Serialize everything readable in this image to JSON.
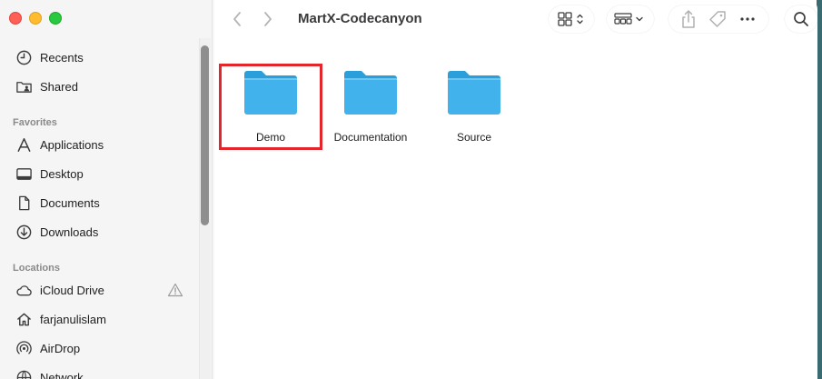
{
  "window": {
    "title": "MartX-Codecanyon"
  },
  "sidebar": {
    "items_top": [
      {
        "label": "Recents",
        "icon": "clock-icon"
      },
      {
        "label": "Shared",
        "icon": "shared-folder-icon"
      }
    ],
    "favorites_title": "Favorites",
    "favorites": [
      {
        "label": "Applications",
        "icon": "applications-icon"
      },
      {
        "label": "Desktop",
        "icon": "desktop-icon"
      },
      {
        "label": "Documents",
        "icon": "document-icon"
      },
      {
        "label": "Downloads",
        "icon": "download-icon"
      }
    ],
    "locations_title": "Locations",
    "locations": [
      {
        "label": "iCloud Drive",
        "icon": "cloud-icon"
      },
      {
        "label": "farjanulislam",
        "icon": "home-icon"
      },
      {
        "label": "AirDrop",
        "icon": "airdrop-icon"
      },
      {
        "label": "Network",
        "icon": "network-icon"
      }
    ]
  },
  "content": {
    "folders": [
      {
        "name": "Demo"
      },
      {
        "name": "Documentation"
      },
      {
        "name": "Source"
      }
    ]
  },
  "colors": {
    "folder": "#3aaee8",
    "highlight": "#e3262b"
  }
}
